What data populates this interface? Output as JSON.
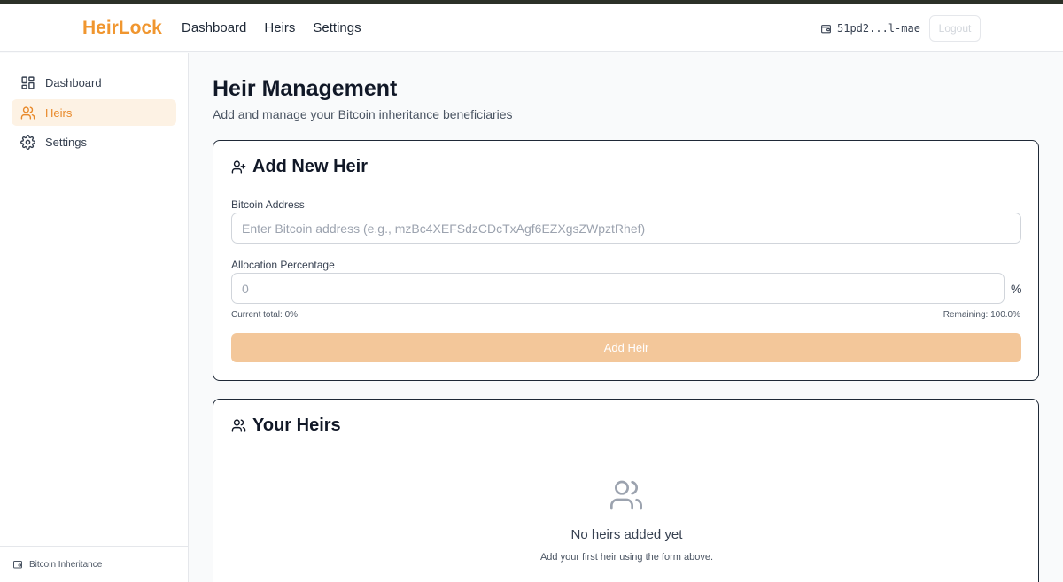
{
  "app": {
    "logo": "HeirLock",
    "nav": [
      "Dashboard",
      "Heirs",
      "Settings"
    ],
    "wallet_address": "51pd2...l-mae",
    "logout_label": "Logout"
  },
  "sidebar": {
    "items": [
      {
        "label": "Dashboard",
        "icon": "dashboard-icon"
      },
      {
        "label": "Heirs",
        "icon": "users-icon",
        "active": true
      },
      {
        "label": "Settings",
        "icon": "gear-icon"
      }
    ],
    "footer": "Bitcoin Inheritance"
  },
  "page": {
    "title": "Heir Management",
    "subtitle": "Add and manage your Bitcoin inheritance beneficiaries"
  },
  "add_heir": {
    "title": "Add New Heir",
    "address_label": "Bitcoin Address",
    "address_placeholder": "Enter Bitcoin address (e.g., mzBc4XEFSdzCDcTxAgf6EZXgsZWpztRhef)",
    "allocation_label": "Allocation Percentage",
    "allocation_placeholder": "0",
    "percent_sign": "%",
    "current_total": "Current total: 0%",
    "remaining": "Remaining: 100.0%",
    "button_label": "Add Heir"
  },
  "heirs_list": {
    "title": "Your Heirs",
    "empty_title": "No heirs added yet",
    "empty_sub": "Add your first heir using the form above."
  },
  "colors": {
    "accent": "#f0962f",
    "accent_light": "#fdf2e4",
    "button_disabled": "#f3c79a"
  }
}
